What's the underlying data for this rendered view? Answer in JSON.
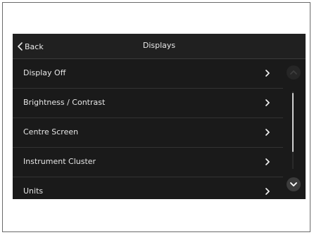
{
  "header": {
    "back_label": "Back",
    "title": "Displays"
  },
  "menu": {
    "items": [
      {
        "label": "Display Off"
      },
      {
        "label": "Brightness / Contrast"
      },
      {
        "label": "Centre Screen"
      },
      {
        "label": "Instrument Cluster"
      },
      {
        "label": "Units"
      }
    ]
  },
  "icons": {
    "back": "chevron-left-icon",
    "row": "chevron-right-icon",
    "scroll_up": "chevron-up-icon",
    "scroll_down": "chevron-down-icon"
  },
  "colors": {
    "screen_bg": "#1a1a1a",
    "header_bg": "#202020",
    "text": "#e8e8e8",
    "divider": "#333333"
  }
}
